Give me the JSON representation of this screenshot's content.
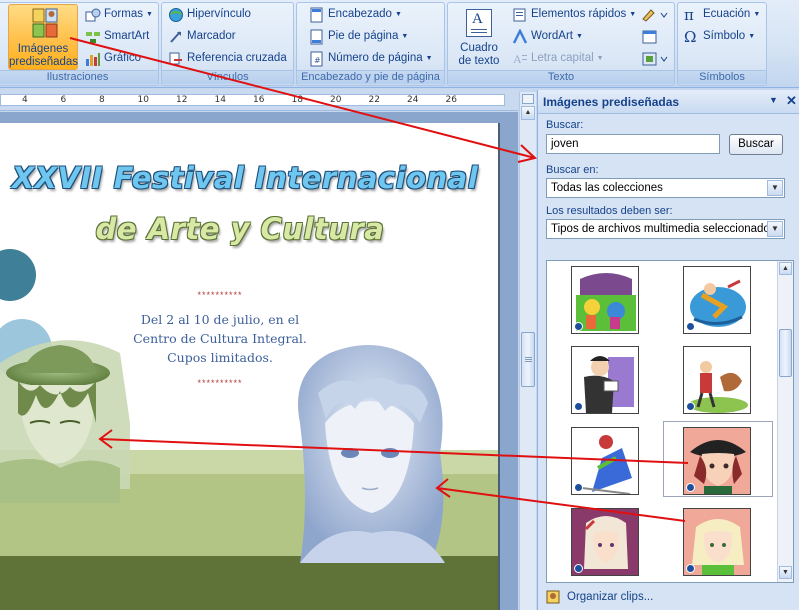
{
  "ribbon": {
    "illustrations": {
      "clipart_label_1": "Imágenes",
      "clipart_label_2": "prediseñadas",
      "shapes": "Formas",
      "smartart": "SmartArt",
      "chart": "Gráfico",
      "group_label": "Ilustraciones"
    },
    "links": {
      "hyperlink": "Hipervínculo",
      "bookmark": "Marcador",
      "crossref": "Referencia cruzada",
      "group_label": "Vínculos"
    },
    "header_footer": {
      "header": "Encabezado",
      "footer": "Pie de página",
      "page_number": "Número de página",
      "group_label": "Encabezado y pie de página"
    },
    "text": {
      "textbox_1": "Cuadro",
      "textbox_2": "de texto",
      "quick_parts": "Elementos rápidos",
      "wordart": "WordArt",
      "drop_cap": "Letra capital",
      "group_label": "Texto"
    },
    "symbols": {
      "equation": "Ecuación",
      "symbol": "Símbolo",
      "group_label": "Símbolos"
    }
  },
  "ruler": {
    "marks": [
      "4",
      "6",
      "8",
      "10",
      "12",
      "14",
      "16",
      "18",
      "20",
      "22",
      "24",
      "26"
    ]
  },
  "document": {
    "title_line1": "XXVII Festival Internacional",
    "title_line2": "de Arte y Cultura",
    "stars": "**********",
    "info_line1": "Del 2 al 10 de julio, en el",
    "info_line2": "Centro de Cultura Integral.",
    "info_line3": "Cupos limitados."
  },
  "pane": {
    "title": "Imágenes prediseñadas",
    "search_label": "Buscar:",
    "search_value": "joven",
    "search_button": "Buscar",
    "search_in_label": "Buscar en:",
    "search_in_value": "Todas las colecciones",
    "results_label": "Los resultados deben ser:",
    "results_value": "Tipos de archivos multimedia seleccionados",
    "organize": "Organizar clips..."
  },
  "colors": {
    "ribbon_text": "#15428b",
    "title_blue": "#6fc6ef",
    "title_green": "#d8e8a5",
    "arrow_red": "#e01010",
    "page_green": "#b8c98d"
  }
}
